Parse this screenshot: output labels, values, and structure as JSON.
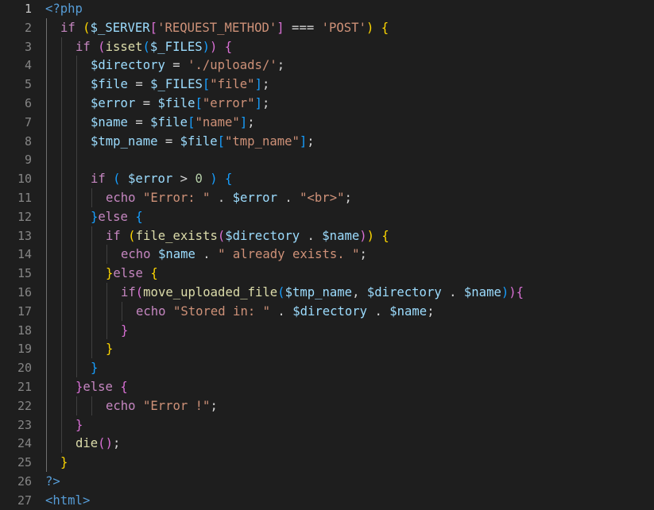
{
  "editor": {
    "language": "php",
    "active_line": 1,
    "colors": {
      "background": "#1e1e1e",
      "keyword": "#c586c0",
      "tag": "#569cd6",
      "variable": "#9cdcfe",
      "function": "#dcdcaa",
      "string": "#ce9178",
      "number": "#b5cea8",
      "operator": "#d4d4d4",
      "bracket_level_1": "#ffd700",
      "bracket_level_2": "#da70d6",
      "bracket_level_3": "#179fff"
    },
    "lines": [
      {
        "n": "1",
        "indent": 0,
        "tokens": [
          [
            "tag",
            "<?php"
          ]
        ]
      },
      {
        "n": "2",
        "indent": 1,
        "tokens": [
          [
            "kw",
            "if"
          ],
          [
            "op",
            " "
          ],
          [
            "b1",
            "("
          ],
          [
            "var",
            "$_SERVER"
          ],
          [
            "b2",
            "["
          ],
          [
            "str",
            "'REQUEST_METHOD'"
          ],
          [
            "b2",
            "]"
          ],
          [
            "op",
            " === "
          ],
          [
            "str",
            "'POST'"
          ],
          [
            "b1",
            ")"
          ],
          [
            "op",
            " "
          ],
          [
            "b1",
            "{"
          ]
        ]
      },
      {
        "n": "3",
        "indent": 2,
        "tokens": [
          [
            "kw",
            "if"
          ],
          [
            "op",
            " "
          ],
          [
            "b2",
            "("
          ],
          [
            "fn",
            "isset"
          ],
          [
            "b3",
            "("
          ],
          [
            "var",
            "$_FILES"
          ],
          [
            "b3",
            ")"
          ],
          [
            "b2",
            ")"
          ],
          [
            "op",
            " "
          ],
          [
            "b2",
            "{"
          ]
        ]
      },
      {
        "n": "4",
        "indent": 3,
        "tokens": [
          [
            "var",
            "$directory"
          ],
          [
            "op",
            " = "
          ],
          [
            "str",
            "'./uploads/'"
          ],
          [
            "op",
            ";"
          ]
        ]
      },
      {
        "n": "5",
        "indent": 3,
        "tokens": [
          [
            "var",
            "$file"
          ],
          [
            "op",
            " = "
          ],
          [
            "var",
            "$_FILES"
          ],
          [
            "b3",
            "["
          ],
          [
            "str",
            "\"file\""
          ],
          [
            "b3",
            "]"
          ],
          [
            "op",
            ";"
          ]
        ]
      },
      {
        "n": "6",
        "indent": 3,
        "tokens": [
          [
            "var",
            "$error"
          ],
          [
            "op",
            " = "
          ],
          [
            "var",
            "$file"
          ],
          [
            "b3",
            "["
          ],
          [
            "str",
            "\"error\""
          ],
          [
            "b3",
            "]"
          ],
          [
            "op",
            ";"
          ]
        ]
      },
      {
        "n": "7",
        "indent": 3,
        "tokens": [
          [
            "var",
            "$name"
          ],
          [
            "op",
            " = "
          ],
          [
            "var",
            "$file"
          ],
          [
            "b3",
            "["
          ],
          [
            "str",
            "\"name\""
          ],
          [
            "b3",
            "]"
          ],
          [
            "op",
            ";"
          ]
        ]
      },
      {
        "n": "8",
        "indent": 3,
        "tokens": [
          [
            "var",
            "$tmp_name"
          ],
          [
            "op",
            " = "
          ],
          [
            "var",
            "$file"
          ],
          [
            "b3",
            "["
          ],
          [
            "str",
            "\"tmp_name\""
          ],
          [
            "b3",
            "]"
          ],
          [
            "op",
            ";"
          ]
        ]
      },
      {
        "n": "9",
        "indent": 3,
        "tokens": []
      },
      {
        "n": "10",
        "indent": 3,
        "tokens": [
          [
            "kw",
            "if"
          ],
          [
            "op",
            " "
          ],
          [
            "b3",
            "("
          ],
          [
            "op",
            " "
          ],
          [
            "var",
            "$error"
          ],
          [
            "op",
            " > "
          ],
          [
            "num",
            "0"
          ],
          [
            "op",
            " "
          ],
          [
            "b3",
            ")"
          ],
          [
            "op",
            " "
          ],
          [
            "b3",
            "{"
          ]
        ]
      },
      {
        "n": "11",
        "indent": 4,
        "tokens": [
          [
            "kw",
            "echo"
          ],
          [
            "op",
            " "
          ],
          [
            "str",
            "\"Error: \""
          ],
          [
            "op",
            " . "
          ],
          [
            "var",
            "$error"
          ],
          [
            "op",
            " . "
          ],
          [
            "str",
            "\"<br>\""
          ],
          [
            "op",
            ";"
          ]
        ]
      },
      {
        "n": "12",
        "indent": 3,
        "tokens": [
          [
            "b3",
            "}"
          ],
          [
            "kw",
            "else"
          ],
          [
            "op",
            " "
          ],
          [
            "b3",
            "{"
          ]
        ]
      },
      {
        "n": "13",
        "indent": 4,
        "tokens": [
          [
            "kw",
            "if"
          ],
          [
            "op",
            " "
          ],
          [
            "b1",
            "("
          ],
          [
            "fn",
            "file_exists"
          ],
          [
            "b2",
            "("
          ],
          [
            "var",
            "$directory"
          ],
          [
            "op",
            " . "
          ],
          [
            "var",
            "$name"
          ],
          [
            "b2",
            ")"
          ],
          [
            "b1",
            ")"
          ],
          [
            "op",
            " "
          ],
          [
            "b1",
            "{"
          ]
        ]
      },
      {
        "n": "14",
        "indent": 5,
        "tokens": [
          [
            "kw",
            "echo"
          ],
          [
            "op",
            " "
          ],
          [
            "var",
            "$name"
          ],
          [
            "op",
            " . "
          ],
          [
            "str",
            "\" already exists. \""
          ],
          [
            "op",
            ";"
          ]
        ]
      },
      {
        "n": "15",
        "indent": 4,
        "tokens": [
          [
            "b1",
            "}"
          ],
          [
            "kw",
            "else"
          ],
          [
            "op",
            " "
          ],
          [
            "b1",
            "{"
          ]
        ]
      },
      {
        "n": "16",
        "indent": 5,
        "tokens": [
          [
            "kw",
            "if"
          ],
          [
            "b2",
            "("
          ],
          [
            "fn",
            "move_uploaded_file"
          ],
          [
            "b3",
            "("
          ],
          [
            "var",
            "$tmp_name"
          ],
          [
            "op",
            ", "
          ],
          [
            "var",
            "$directory"
          ],
          [
            "op",
            " . "
          ],
          [
            "var",
            "$name"
          ],
          [
            "b3",
            ")"
          ],
          [
            "b2",
            ")"
          ],
          [
            "b2",
            "{"
          ]
        ]
      },
      {
        "n": "17",
        "indent": 6,
        "tokens": [
          [
            "kw",
            "echo"
          ],
          [
            "op",
            " "
          ],
          [
            "str",
            "\"Stored in: \""
          ],
          [
            "op",
            " . "
          ],
          [
            "var",
            "$directory"
          ],
          [
            "op",
            " . "
          ],
          [
            "var",
            "$name"
          ],
          [
            "op",
            ";"
          ]
        ]
      },
      {
        "n": "18",
        "indent": 5,
        "tokens": [
          [
            "b2",
            "}"
          ]
        ]
      },
      {
        "n": "19",
        "indent": 4,
        "tokens": [
          [
            "b1",
            "}"
          ]
        ]
      },
      {
        "n": "20",
        "indent": 3,
        "tokens": [
          [
            "b3",
            "}"
          ]
        ]
      },
      {
        "n": "21",
        "indent": 2,
        "tokens": [
          [
            "b2",
            "}"
          ],
          [
            "kw",
            "else"
          ],
          [
            "op",
            " "
          ],
          [
            "b2",
            "{"
          ]
        ]
      },
      {
        "n": "22",
        "indent": 4,
        "tokens": [
          [
            "kw",
            "echo"
          ],
          [
            "op",
            " "
          ],
          [
            "str",
            "\"Error !\""
          ],
          [
            "op",
            ";"
          ]
        ]
      },
      {
        "n": "23",
        "indent": 2,
        "tokens": [
          [
            "b2",
            "}"
          ]
        ]
      },
      {
        "n": "24",
        "indent": 2,
        "tokens": [
          [
            "fn",
            "die"
          ],
          [
            "b2",
            "("
          ],
          [
            "b2",
            ")"
          ],
          [
            "op",
            ";"
          ]
        ]
      },
      {
        "n": "25",
        "indent": 1,
        "tokens": [
          [
            "b1",
            "}"
          ]
        ]
      },
      {
        "n": "26",
        "indent": 0,
        "tokens": [
          [
            "tag",
            "?>"
          ]
        ]
      },
      {
        "n": "27",
        "indent": 0,
        "tokens": [
          [
            "tag",
            "<html>"
          ]
        ]
      }
    ]
  }
}
